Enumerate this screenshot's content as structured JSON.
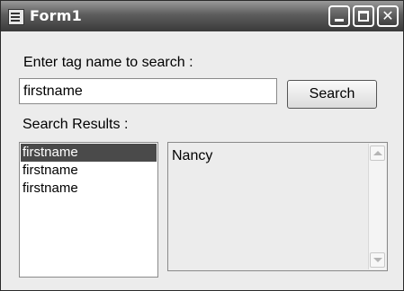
{
  "window": {
    "title": "Form1",
    "icon": "form-app-icon",
    "controls": [
      "minimize-icon",
      "maximize-icon",
      "close-icon"
    ],
    "close_glyph": "✕"
  },
  "search": {
    "label": "Enter tag name to search :",
    "input_value": "firstname",
    "button_label": "Search"
  },
  "results": {
    "label": "Search Results :",
    "items": [
      "firstname",
      "firstname",
      "firstname"
    ],
    "selected_index": 0
  },
  "detail": {
    "text": "Nancy"
  },
  "colors": {
    "selection_background": "#4a4a4a",
    "titlebar_top": "#9a9a9a",
    "titlebar_bottom": "#3a3a3a"
  }
}
